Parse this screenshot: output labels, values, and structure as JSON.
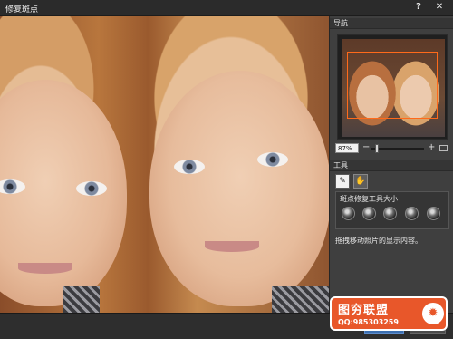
{
  "window": {
    "title": "修复斑点",
    "help_label": "?",
    "close_label": "✕"
  },
  "navigator": {
    "header": "导航",
    "zoom_value": "87%",
    "zoom_minus": "−",
    "zoom_plus": "+"
  },
  "tools": {
    "header": "工具",
    "items": [
      {
        "name": "spot-heal-brush-icon",
        "glyph": "✎"
      },
      {
        "name": "hand-tool-icon",
        "glyph": "✋"
      }
    ],
    "size_label": "斑点修复工具大小",
    "brush_sizes": 5,
    "hint": "拖拽移动照片的显示内容。"
  },
  "colors": {
    "accent": "#3b6fb0",
    "viewbox": "#ff6a1a",
    "watermark": "#e8572a"
  },
  "watermark": {
    "name": "图穷联盟",
    "qq": "QQ:985303259",
    "logo_glyph": "✹"
  }
}
